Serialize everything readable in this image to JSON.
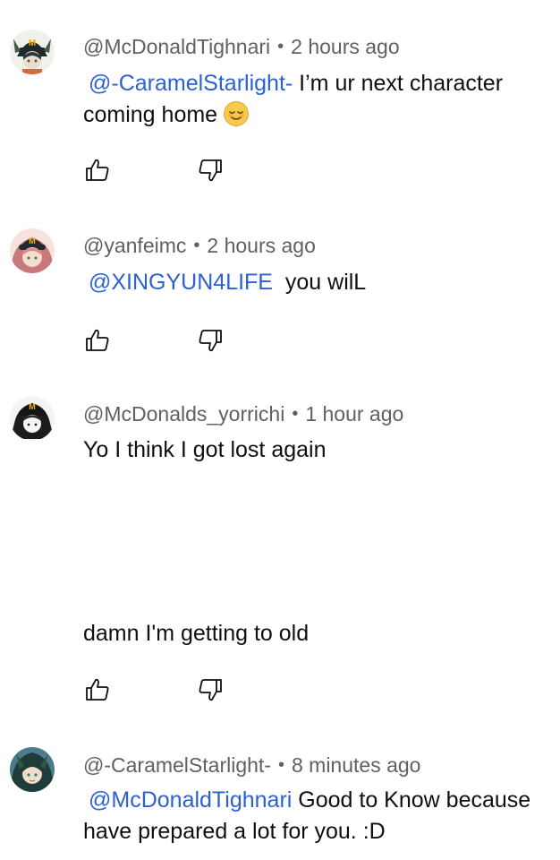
{
  "colors": {
    "mention": "#2c61d1",
    "meta_text": "#606060",
    "body_text": "#0f0f0f",
    "background": "#ffffff"
  },
  "comments": [
    {
      "author": "@McDonaldTighnari",
      "separator": "•",
      "time": "2 hours ago",
      "mention": "@-CaramelStarlight-",
      "text": "I’m ur next character coming home",
      "emoji": "relieved-face-emoji",
      "avatar_icon": "tighnari-mcdonalds-avatar"
    },
    {
      "author": "@yanfeimc",
      "separator": "•",
      "time": "2 hours ago",
      "mention": "@XINGYUN4LIFE",
      "text": "you wilL",
      "avatar_icon": "yanfei-mcdonalds-avatar"
    },
    {
      "author": "@McDonalds_yorrichi",
      "separator": "•",
      "time": "1 hour ago",
      "text_line1": "Yo I think I got lost again",
      "text_line2": "damn I'm getting to old",
      "avatar_icon": "yorrichi-mcdonalds-avatar"
    },
    {
      "author": "@-CaramelStarlight-",
      "separator": "•",
      "time": "8 minutes ago",
      "mention": "@McDonaldTighnari",
      "text_line1": "Good to Know because",
      "text_line2": "have prepared a lot for you. :D",
      "avatar_icon": "caramelstarlight-avatar"
    }
  ],
  "actions": {
    "like_icon": "thumbs-up-icon",
    "dislike_icon": "thumbs-down-icon"
  }
}
